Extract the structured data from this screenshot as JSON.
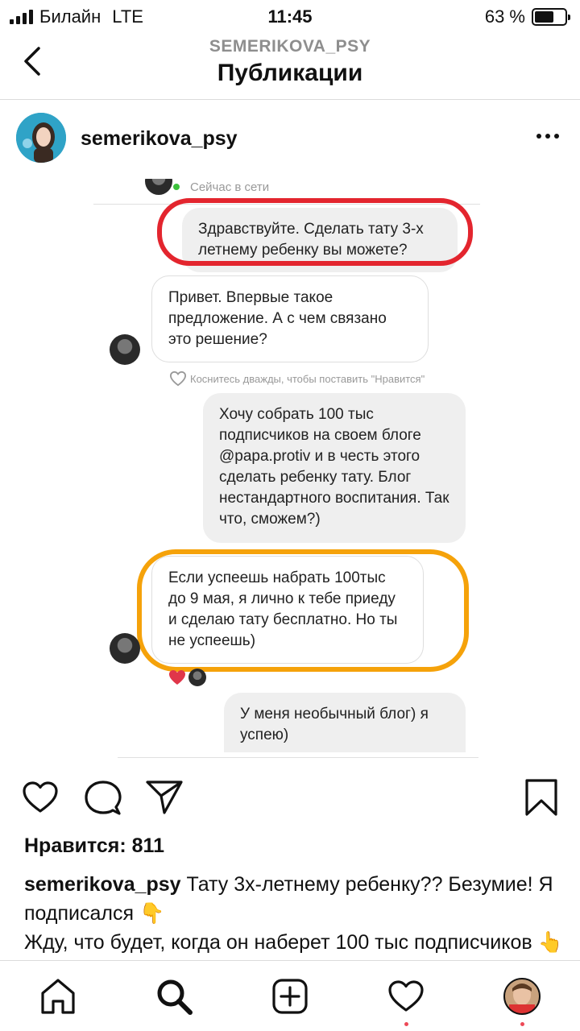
{
  "status": {
    "carrier": "Билайн",
    "network": "LTE",
    "time": "11:45",
    "battery": "63 %",
    "battery_level": 0.63
  },
  "header": {
    "subtitle": "SEMERIKOVA_PSY",
    "title": "Публикации"
  },
  "post": {
    "username": "semerikova_psy",
    "image": {
      "online_status": "Сейчас в сети",
      "messages": [
        {
          "side": "out",
          "text": "Здравствуйте. Сделать тату 3-х летнему ребенку вы можете?"
        },
        {
          "side": "in",
          "text": "Привет. Впервые такое предложение. А с чем связано это решение?"
        },
        {
          "side": "out",
          "text": "Хочу собрать 100 тыс подписчиков на своем блоге @papa.protiv и в честь этого сделать ребенку тату. Блог нестандартного воспитания. Так что, сможем?)"
        },
        {
          "side": "in",
          "text": "Если успеешь набрать 100тыс до 9 мая, я лично к тебе приеду и сделаю тату бесплатно. Но ты не успеешь)"
        },
        {
          "side": "out",
          "text": "У меня необычный блог) я успею)"
        }
      ],
      "like_hint": "Коснитесь дважды, чтобы поставить \"Нравится\""
    },
    "likes": "Нравится: 811",
    "caption_user": "semerikova_psy",
    "caption_text": " Тату 3х-летнему ребенку?? Безумие! Я подписался 👇",
    "caption_text2": " Жду, что будет, когда он наберет 100 тыс подписчиков 👆"
  },
  "colors": {
    "highlight_red": "#e3252e",
    "highlight_orange": "#f5a20a",
    "notification_dot": "#ed4956"
  }
}
